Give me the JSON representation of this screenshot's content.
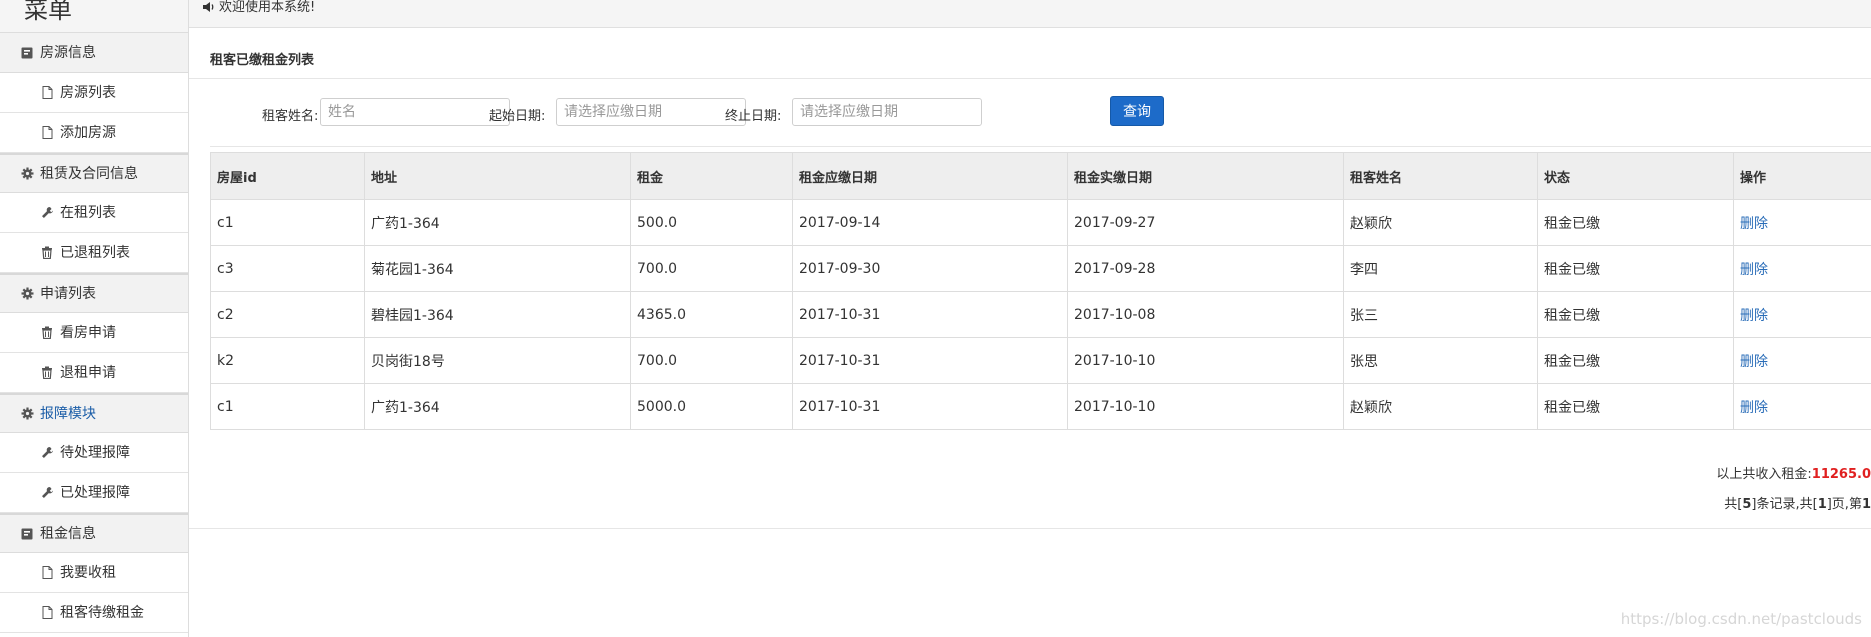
{
  "sidebar": {
    "title": "菜单",
    "sections": [
      {
        "label": "房源信息",
        "icon": "book-icon",
        "items": [
          {
            "label": "房源列表",
            "icon": "file-icon"
          },
          {
            "label": "添加房源",
            "icon": "file-icon"
          }
        ]
      },
      {
        "label": "租赁及合同信息",
        "icon": "gear-icon",
        "items": [
          {
            "label": "在租列表",
            "icon": "wrench-icon"
          },
          {
            "label": "已退租列表",
            "icon": "trash-icon"
          }
        ]
      },
      {
        "label": "申请列表",
        "icon": "gear-icon",
        "items": [
          {
            "label": "看房申请",
            "icon": "trash-icon"
          },
          {
            "label": "退租申请",
            "icon": "trash-icon"
          }
        ]
      },
      {
        "label": "报障模块",
        "icon": "gear-icon",
        "active": true,
        "items": [
          {
            "label": "待处理报障",
            "icon": "wrench-icon"
          },
          {
            "label": "已处理报障",
            "icon": "wrench-icon"
          }
        ]
      },
      {
        "label": "租金信息",
        "icon": "book-icon",
        "items": [
          {
            "label": "我要收租",
            "icon": "file-icon"
          },
          {
            "label": "租客待缴租金",
            "icon": "file-icon"
          }
        ]
      }
    ]
  },
  "topbar": {
    "welcome": "欢迎使用本系统!",
    "icon": "volume-icon"
  },
  "panel": {
    "title": "租客已缴租金列表"
  },
  "search": {
    "name_label": "租客姓名:",
    "name_placeholder": "姓名",
    "start_label": "起始日期:",
    "start_placeholder": "请选择应缴日期",
    "end_label": "终止日期:",
    "end_placeholder": "请选择应缴日期",
    "button": "查询"
  },
  "table": {
    "headers": [
      "房屋id",
      "地址",
      "租金",
      "租金应缴日期",
      "租金实缴日期",
      "租客姓名",
      "状态",
      "操作"
    ],
    "rows": [
      [
        "c1",
        "广药1-364",
        "500.0",
        "2017-09-14",
        "2017-09-27",
        "赵颖欣",
        "租金已缴",
        "删除"
      ],
      [
        "c3",
        "菊花园1-364",
        "700.0",
        "2017-09-30",
        "2017-09-28",
        "李四",
        "租金已缴",
        "删除"
      ],
      [
        "c2",
        "碧桂园1-364",
        "4365.0",
        "2017-10-31",
        "2017-10-08",
        "张三",
        "租金已缴",
        "删除"
      ],
      [
        "k2",
        "贝岗街18号",
        "700.0",
        "2017-10-31",
        "2017-10-10",
        "张思",
        "租金已缴",
        "删除"
      ],
      [
        "c1",
        "广药1-364",
        "5000.0",
        "2017-10-31",
        "2017-10-10",
        "赵颖欣",
        "租金已缴",
        "删除"
      ]
    ]
  },
  "summary": {
    "label": "以上共收入租金:",
    "amount": "11265.0"
  },
  "pager": {
    "p1": "共[",
    "records": "5",
    "p2": "]条记录,共[",
    "pages": "1",
    "p3": "]页,第",
    "current": "1"
  },
  "watermark": "https://blog.csdn.net/pastclouds",
  "colors": {
    "accent": "#1d6bc9",
    "link": "#2a6db8",
    "total": "#e02020"
  }
}
